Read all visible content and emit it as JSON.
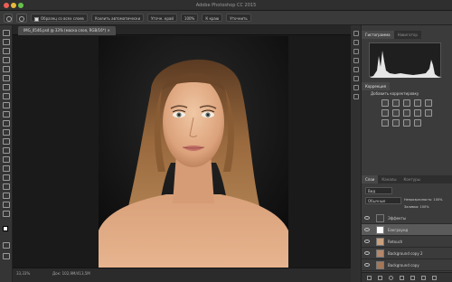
{
  "window": {
    "title": "Adobe Photoshop CC 2015"
  },
  "options_bar": {
    "sample_all_layers": "Образец со всех слоев",
    "auto_enhance": "Усилить автоматически",
    "refine_edge": "Уточн. край",
    "chips": [
      "100%",
      "К краю",
      "Уточнить"
    ]
  },
  "document_tab": {
    "label": "IMG_0546.psd @ 33% (маска слоя, RGB/16*)"
  },
  "status_bar": {
    "zoom": "33,33%",
    "doc_size": "Док: 102,9M/413,5M"
  },
  "panels": {
    "top_tabs": [
      "Гистограмма",
      "Навигатор"
    ],
    "adjustments_tab": "Коррекция",
    "adjustments_hint": "Добавить корректировку",
    "layers_tabs": [
      "Слои",
      "Каналы",
      "Контуры"
    ],
    "kind_filter": "Вид",
    "blend_mode": "Обычные",
    "opacity": "Непрозрачность: 100%",
    "fill": "Заливка: 100%",
    "layers": [
      {
        "name": "Эффекты"
      },
      {
        "name": "Бэкграунд"
      },
      {
        "name": "Retouch"
      },
      {
        "name": "Background copy 2"
      },
      {
        "name": "Background copy"
      }
    ]
  },
  "colors": {
    "accent": "#3b6bd6",
    "chrome": "#3a3a3a",
    "canvas": "#1a1a1a"
  }
}
